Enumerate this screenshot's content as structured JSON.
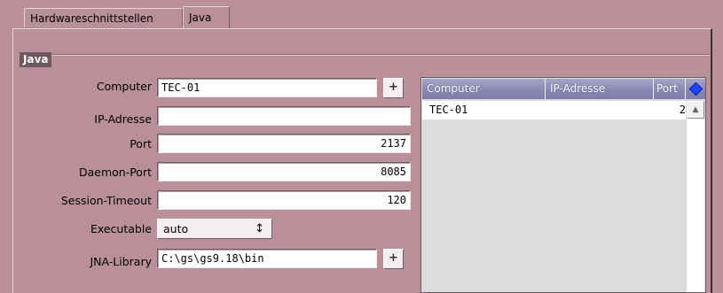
{
  "tabs": [
    {
      "label": "Hardwareschnittstellen"
    },
    {
      "label": "Java"
    }
  ],
  "group": {
    "title": "Java"
  },
  "form": {
    "computer": {
      "label": "Computer",
      "value": "TEC-01"
    },
    "ip": {
      "label": "IP-Adresse",
      "value": ""
    },
    "port": {
      "label": "Port",
      "value": "2137"
    },
    "daemon_port": {
      "label": "Daemon-Port",
      "value": "8085"
    },
    "session_timeout": {
      "label": "Session-Timeout",
      "value": "120"
    },
    "executable": {
      "label": "Executable",
      "value": "auto"
    },
    "jna_library": {
      "label": "JNA-Library",
      "value": "C:\\gs\\gs9.18\\bin"
    },
    "add_button_label": "+"
  },
  "table": {
    "columns": [
      "Computer",
      "IP-Adresse",
      "Port"
    ],
    "rows": [
      {
        "computer": "TEC-01",
        "ip": "",
        "port": "2"
      }
    ]
  },
  "colors": {
    "background": "#b98f99",
    "header": "#8786b1",
    "accent": "#1f46ff"
  },
  "icons": {
    "column_chooser": "diamond-icon",
    "scroll_up": "arrow-up-icon",
    "dropdown": "updown-arrows-icon"
  }
}
